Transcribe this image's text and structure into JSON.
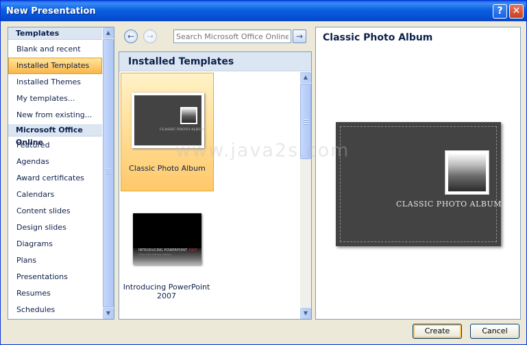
{
  "window": {
    "title": "New Presentation",
    "help_glyph": "?",
    "close_glyph": "✕"
  },
  "sidebar": {
    "headers": [
      "Templates",
      "Microsoft Office Online"
    ],
    "items": [
      "Blank and recent",
      "Installed Templates",
      "Installed Themes",
      "My templates...",
      "New from existing..."
    ],
    "online_items": [
      "Featured",
      "Agendas",
      "Award certificates",
      "Calendars",
      "Content slides",
      "Design slides",
      "Diagrams",
      "Plans",
      "Presentations",
      "Resumes",
      "Schedules"
    ],
    "selected": "Installed Templates"
  },
  "nav": {
    "back_glyph": "←",
    "forward_glyph": "→",
    "search_placeholder": "Search Microsoft Office Online fo",
    "go_glyph": "→"
  },
  "gallery": {
    "header": "Installed Templates",
    "tiles": [
      {
        "label": "Classic Photo Album",
        "thumb_caption": "CLASSIC PHOTO ALBUM",
        "selected": true
      },
      {
        "label": "Introducing PowerPoint 2007",
        "thumb_title_a": "INTRODUCING POWERPOINT",
        "thumb_title_b": "2007",
        "thumb_subtitle": "A tour of the new user interface",
        "selected": false
      }
    ]
  },
  "preview": {
    "title": "Classic Photo Album",
    "caption": "CLASSIC PHOTO ALBUM"
  },
  "buttons": {
    "create": "Create",
    "cancel": "Cancel"
  },
  "scrollbar_glyphs": {
    "up": "▲",
    "down": "▼"
  },
  "watermark": "www.java2s.com",
  "colors": {
    "selection_orange": "#ffc868",
    "header_blue": "#dbe6f2",
    "title_bar": "#0550d4",
    "slide_gray": "#434343"
  }
}
